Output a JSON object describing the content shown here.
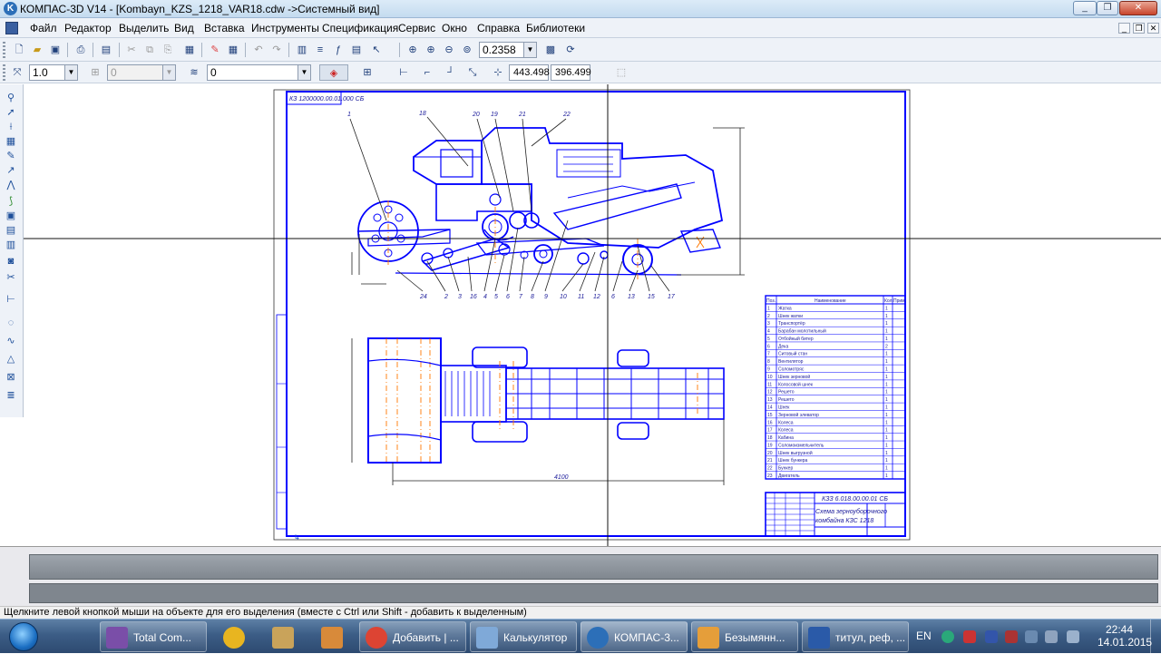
{
  "window": {
    "title": "КОМПАС-3D V14 - [Kombayn_KZS_1218_VAR18.cdw ->Системный вид]",
    "controls": [
      "_",
      "❐",
      "✕"
    ]
  },
  "menu": {
    "items": [
      "Файл",
      "Редактор",
      "Выделить",
      "Вид",
      "Вставка",
      "Инструменты",
      "Спецификация",
      "Сервис",
      "Окно",
      "Справка",
      "Библиотеки"
    ],
    "mdi_controls": [
      "_",
      "❐",
      "✕"
    ]
  },
  "toolbar1": {
    "zoom_value": "0.2358"
  },
  "toolbar2": {
    "scale_value": "1.0",
    "state_value": "0",
    "layer_value": "0",
    "coord_x": "443.498",
    "coord_y": "396.499"
  },
  "drawing": {
    "corner_code": "КЗ 1200000.00.01.000 СБ",
    "leader_numbers_top": [
      "1",
      "18",
      "20",
      "19",
      "21",
      "22"
    ],
    "leader_numbers_bottom": [
      "24",
      "2",
      "3",
      "16",
      "4",
      "5",
      "6",
      "7",
      "8",
      "9",
      "10",
      "11",
      "12",
      "6",
      "13",
      "15",
      "17"
    ],
    "legend_header": [
      "Поз.",
      "Наименование",
      "Кол.",
      "Прим."
    ],
    "legend_rows": [
      [
        "1",
        "Жатка",
        "1"
      ],
      [
        "2",
        "Шнек жатки",
        "1"
      ],
      [
        "3",
        "Транспортёр",
        "1"
      ],
      [
        "4",
        "Барабан молотильный",
        "1"
      ],
      [
        "5",
        "Отбойный битер",
        "1"
      ],
      [
        "6",
        "Дека",
        "2"
      ],
      [
        "7",
        "Ситовый стан",
        "1"
      ],
      [
        "8",
        "Вентилятор",
        "1"
      ],
      [
        "9",
        "Соломотряс",
        "1"
      ],
      [
        "10",
        "Шнек зерновой",
        "1"
      ],
      [
        "11",
        "Колосовой шнек",
        "1"
      ],
      [
        "12",
        "Решето",
        "1"
      ],
      [
        "13",
        "Решето",
        "1"
      ],
      [
        "14",
        "Шнек",
        "1"
      ],
      [
        "15",
        "Зерновой элеватор",
        "1"
      ],
      [
        "16",
        "Колеса",
        "1"
      ],
      [
        "17",
        "Колеса",
        "1"
      ],
      [
        "18",
        "Кабина",
        "1"
      ],
      [
        "19",
        "Соломоизмельчитель",
        "1"
      ],
      [
        "20",
        "Шнек выгрузной",
        "1"
      ],
      [
        "21",
        "Шнек бункера",
        "1"
      ],
      [
        "22",
        "Бункер",
        "1"
      ],
      [
        "23",
        "Двигатель",
        "1"
      ]
    ],
    "title_block": {
      "doc_code": "КЗЗ 6.018.00.00.01 СБ",
      "name_line1": "Схема зерноуборочного",
      "name_line2": "комбайна КЗС 1218"
    },
    "dimension_bottom": "4100"
  },
  "status_bar": {
    "message": "Щелкните левой кнопкой мыши на объекте для его выделения (вместе с Ctrl или Shift - добавить к выделенным)"
  },
  "taskbar": {
    "apps": [
      {
        "label": "Total Com...",
        "color": "#7a4ea8"
      },
      {
        "label": "",
        "color": "#e8b520"
      },
      {
        "label": "",
        "color": "#c9a35a"
      },
      {
        "label": "",
        "color": "#d88a3a"
      },
      {
        "label": "Добавить | ...",
        "color": "#dd4433"
      },
      {
        "label": "Калькулятор",
        "color": "#7fa9d8"
      },
      {
        "label": "КОМПАС-3...",
        "color": "#2c6fb8"
      },
      {
        "label": "Безымянн...",
        "color": "#e59e3a"
      },
      {
        "label": "титул, реф, ...",
        "color": "#2a5aa8"
      }
    ],
    "tray": {
      "language": "EN",
      "time": "22:44",
      "date": "14.01.2015"
    }
  }
}
